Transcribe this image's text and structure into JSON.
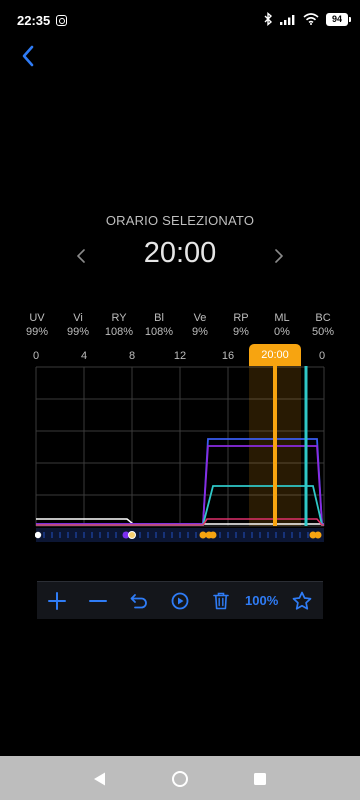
{
  "status_bar": {
    "time": "22:35",
    "battery": "94"
  },
  "schedule": {
    "section_label": "ORARIO SELEZIONATO",
    "selected_time": "20:00"
  },
  "channels": [
    {
      "name": "UV",
      "value": "99%"
    },
    {
      "name": "Vi",
      "value": "99%"
    },
    {
      "name": "RY",
      "value": "108%"
    },
    {
      "name": "Bl",
      "value": "108%"
    },
    {
      "name": "Ve",
      "value": "9%"
    },
    {
      "name": "RP",
      "value": "9%"
    },
    {
      "name": "ML",
      "value": "0%"
    },
    {
      "name": "BC",
      "value": "50%"
    }
  ],
  "timeline": {
    "hour_labels": [
      "0",
      "4",
      "8",
      "12",
      "16",
      "20",
      "0"
    ],
    "selected_label": "20:00",
    "accent": "#f7a410"
  },
  "toolbar": {
    "zoom": "100%",
    "accent": "#2f7cf6"
  },
  "colors": {
    "background": "#000000",
    "white_line": "#ffffff",
    "blue_line": "#3a5cf0",
    "purple_line": "#8a2be2",
    "cyan_line": "#2fc8c8",
    "red_line": "#e0306a"
  }
}
